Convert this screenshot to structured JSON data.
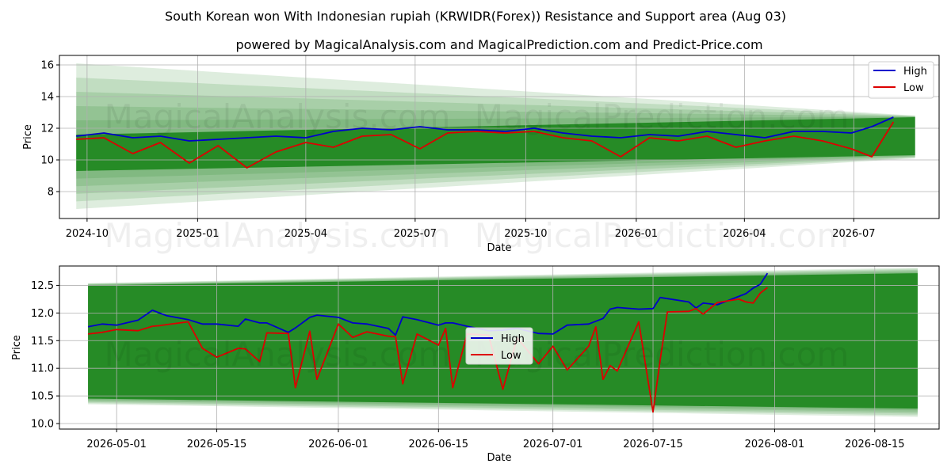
{
  "title": "South Korean won With Indonesian rupiah (KRWIDR(Forex)) Resistance and Support area (Aug 03)",
  "subtitle": "powered by MagicalAnalysis.com and MagicalPrediction.com and Predict-Price.com",
  "watermarks": [
    "MagicalAnalysis.com",
    "MagicalPrediction.com"
  ],
  "colors": {
    "high": "#0000cc",
    "low": "#dd0000",
    "band": "#168216",
    "grid": "#b0b0b0"
  },
  "chart_data": [
    {
      "type": "line",
      "xlabel": "Date",
      "ylabel": "Price",
      "xlim": [
        "2024-09-08",
        "2026-09-10"
      ],
      "ylim": [
        6.3,
        16.6
      ],
      "grid": true,
      "legend_position": "top-right",
      "yticks": [
        8,
        10,
        12,
        14,
        16
      ],
      "xticks": [
        "2024-10",
        "2025-01",
        "2025-04",
        "2025-07",
        "2025-10",
        "2026-01",
        "2026-04",
        "2026-07"
      ],
      "xtick_dates": [
        "2024-10-01",
        "2025-01-01",
        "2025-04-01",
        "2025-07-01",
        "2025-10-01",
        "2026-01-01",
        "2026-04-01",
        "2026-07-01"
      ],
      "band": {
        "x": [
          "2024-09-22",
          "2026-08-21"
        ],
        "upper_outer": [
          16.1,
          12.8
        ],
        "lower_outer": [
          6.9,
          10.1
        ],
        "upper_inner": [
          11.6,
          12.7
        ],
        "lower_inner": [
          9.3,
          10.3
        ]
      },
      "series": [
        {
          "name": "High",
          "x": [
            "2024-09-22",
            "2024-10-15",
            "2024-11-08",
            "2024-12-01",
            "2024-12-25",
            "2025-01-18",
            "2025-02-11",
            "2025-03-07",
            "2025-04-01",
            "2025-04-24",
            "2025-05-18",
            "2025-06-11",
            "2025-07-05",
            "2025-07-28",
            "2025-08-21",
            "2025-09-14",
            "2025-10-08",
            "2025-11-01",
            "2025-11-25",
            "2025-12-19",
            "2026-01-12",
            "2026-02-05",
            "2026-03-01",
            "2026-03-25",
            "2026-04-18",
            "2026-05-12",
            "2026-06-05",
            "2026-06-29",
            "2026-07-16",
            "2026-08-03"
          ],
          "values": [
            11.5,
            11.7,
            11.4,
            11.5,
            11.2,
            11.3,
            11.4,
            11.5,
            11.4,
            11.8,
            12.0,
            11.9,
            12.1,
            11.9,
            11.9,
            11.8,
            12.0,
            11.7,
            11.5,
            11.4,
            11.6,
            11.5,
            11.8,
            11.6,
            11.4,
            11.8,
            11.8,
            11.7,
            12.1,
            12.7
          ]
        },
        {
          "name": "Low",
          "x": [
            "2024-09-22",
            "2024-10-15",
            "2024-11-08",
            "2024-12-01",
            "2024-12-25",
            "2025-01-18",
            "2025-02-11",
            "2025-03-07",
            "2025-04-01",
            "2025-04-24",
            "2025-05-18",
            "2025-06-11",
            "2025-07-05",
            "2025-07-28",
            "2025-08-21",
            "2025-09-14",
            "2025-10-08",
            "2025-11-01",
            "2025-11-25",
            "2025-12-19",
            "2026-01-12",
            "2026-02-05",
            "2026-03-01",
            "2026-03-25",
            "2026-04-18",
            "2026-05-12",
            "2026-06-05",
            "2026-06-29",
            "2026-07-16",
            "2026-08-03"
          ],
          "values": [
            11.3,
            11.4,
            10.4,
            11.1,
            9.8,
            10.9,
            9.5,
            10.5,
            11.1,
            10.8,
            11.5,
            11.6,
            10.7,
            11.7,
            11.8,
            11.7,
            11.8,
            11.4,
            11.2,
            10.2,
            11.4,
            11.2,
            11.5,
            10.8,
            11.2,
            11.5,
            11.2,
            10.7,
            10.2,
            12.4
          ]
        }
      ]
    },
    {
      "type": "line",
      "xlabel": "Date",
      "ylabel": "Price",
      "xlim": [
        "2026-04-23",
        "2026-08-24"
      ],
      "ylim": [
        9.9,
        12.85
      ],
      "grid": true,
      "legend_position": "center",
      "yticks": [
        10.0,
        10.5,
        11.0,
        11.5,
        12.0,
        12.5
      ],
      "xticks": [
        "2026-05-01",
        "2026-05-15",
        "2026-06-01",
        "2026-06-15",
        "2026-07-01",
        "2026-07-15",
        "2026-08-01",
        "2026-08-15"
      ],
      "band": {
        "x": [
          "2026-04-27",
          "2026-08-21"
        ],
        "upper_outer": [
          12.54,
          12.82
        ],
        "lower_outer": [
          10.35,
          10.12
        ],
        "upper_inner": [
          12.5,
          12.72
        ],
        "lower_inner": [
          10.45,
          10.27
        ]
      },
      "series": [
        {
          "name": "High",
          "x": [
            "2026-04-27",
            "2026-04-29",
            "2026-05-01",
            "2026-05-04",
            "2026-05-06",
            "2026-05-07",
            "2026-05-08",
            "2026-05-11",
            "2026-05-13",
            "2026-05-15",
            "2026-05-18",
            "2026-05-19",
            "2026-05-21",
            "2026-05-22",
            "2026-05-25",
            "2026-05-26",
            "2026-05-28",
            "2026-05-29",
            "2026-06-01",
            "2026-06-03",
            "2026-06-05",
            "2026-06-08",
            "2026-06-09",
            "2026-06-10",
            "2026-06-12",
            "2026-06-15",
            "2026-06-16",
            "2026-06-17",
            "2026-06-19",
            "2026-06-22",
            "2026-06-24",
            "2026-06-26",
            "2026-06-29",
            "2026-07-01",
            "2026-07-03",
            "2026-07-06",
            "2026-07-07",
            "2026-07-08",
            "2026-07-09",
            "2026-07-10",
            "2026-07-13",
            "2026-07-15",
            "2026-07-16",
            "2026-07-17",
            "2026-07-20",
            "2026-07-21",
            "2026-07-22",
            "2026-07-24",
            "2026-07-27",
            "2026-07-28",
            "2026-07-29",
            "2026-07-30",
            "2026-07-31"
          ],
          "values": [
            11.75,
            11.8,
            11.78,
            11.87,
            12.05,
            12.0,
            11.95,
            11.88,
            11.8,
            11.8,
            11.76,
            11.89,
            11.82,
            11.82,
            11.65,
            11.73,
            11.92,
            11.96,
            11.92,
            11.82,
            11.8,
            11.72,
            11.6,
            11.93,
            11.88,
            11.78,
            11.82,
            11.82,
            11.76,
            11.68,
            11.69,
            11.72,
            11.63,
            11.62,
            11.78,
            11.8,
            11.85,
            11.9,
            12.07,
            12.1,
            12.07,
            12.08,
            12.28,
            12.26,
            12.2,
            12.09,
            12.18,
            12.15,
            12.3,
            12.35,
            12.45,
            12.52,
            12.72
          ]
        },
        {
          "name": "Low",
          "x": [
            "2026-04-27",
            "2026-04-29",
            "2026-05-01",
            "2026-05-04",
            "2026-05-06",
            "2026-05-07",
            "2026-05-08",
            "2026-05-11",
            "2026-05-13",
            "2026-05-15",
            "2026-05-18",
            "2026-05-19",
            "2026-05-21",
            "2026-05-22",
            "2026-05-25",
            "2026-05-26",
            "2026-05-28",
            "2026-05-29",
            "2026-06-01",
            "2026-06-03",
            "2026-06-05",
            "2026-06-08",
            "2026-06-09",
            "2026-06-10",
            "2026-06-12",
            "2026-06-15",
            "2026-06-16",
            "2026-06-17",
            "2026-06-19",
            "2026-06-22",
            "2026-06-24",
            "2026-06-26",
            "2026-06-29",
            "2026-07-01",
            "2026-07-03",
            "2026-07-06",
            "2026-07-07",
            "2026-07-08",
            "2026-07-09",
            "2026-07-10",
            "2026-07-13",
            "2026-07-15",
            "2026-07-16",
            "2026-07-17",
            "2026-07-20",
            "2026-07-21",
            "2026-07-22",
            "2026-07-24",
            "2026-07-27",
            "2026-07-28",
            "2026-07-29",
            "2026-07-30",
            "2026-07-31"
          ],
          "values": [
            11.62,
            11.65,
            11.7,
            11.68,
            11.76,
            11.77,
            11.79,
            11.84,
            11.36,
            11.2,
            11.36,
            11.35,
            11.12,
            11.64,
            11.63,
            10.65,
            11.67,
            10.8,
            11.8,
            11.56,
            11.66,
            11.58,
            11.57,
            10.72,
            11.62,
            11.42,
            11.72,
            10.65,
            11.62,
            11.6,
            10.62,
            11.55,
            11.08,
            11.4,
            10.97,
            11.4,
            11.75,
            10.8,
            11.05,
            10.95,
            11.84,
            10.21,
            11.15,
            12.02,
            12.03,
            12.08,
            11.98,
            12.19,
            12.25,
            12.2,
            12.18,
            12.36,
            12.46
          ]
        }
      ]
    }
  ]
}
